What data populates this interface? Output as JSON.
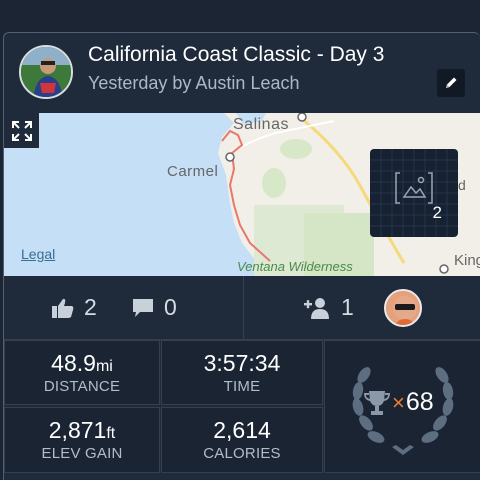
{
  "activity": {
    "title": "California Coast Classic - Day 3",
    "subtitle": "Yesterday by Austin Leach"
  },
  "map": {
    "places": {
      "salinas": "Salinas",
      "carmel": "Carmel",
      "ventana": "Ventana Wilderness",
      "king": "King",
      "partial_d": "d"
    },
    "legal_link": "Legal",
    "photo_count": "2"
  },
  "social": {
    "kudos_count": "2",
    "comment_count": "0",
    "follower_count": "1"
  },
  "stats": {
    "distance": {
      "value": "48.9",
      "unit": "mi",
      "label": "DISTANCE"
    },
    "time": {
      "value": "3:57:34",
      "label": "TIME"
    },
    "elev_gain": {
      "value": "2,871",
      "unit": "ft",
      "label": "ELEV GAIN"
    },
    "calories": {
      "value": "2,614",
      "label": "CALORIES"
    }
  },
  "achievements": {
    "multiplier": "×",
    "count": "68"
  },
  "colors": {
    "background": "#1b2533",
    "card": "#1f2b3b",
    "water": "#c4dff6",
    "route": "#e8786c",
    "trophy_gray": "#7a8897",
    "accent_orange": "#f07c2e"
  },
  "icons": {
    "edit": "pencil-icon",
    "expand": "expand-icon",
    "photo": "image-icon",
    "kudos": "thumbs-up-icon",
    "comment": "comment-icon",
    "add_follower": "add-user-icon",
    "trophy": "trophy-icon"
  }
}
